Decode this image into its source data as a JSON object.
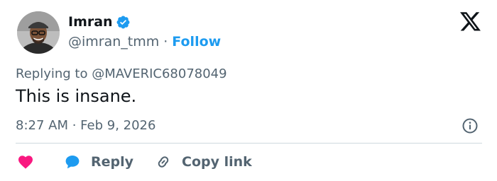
{
  "author": {
    "display_name": "Imran",
    "handle": "@imran_tmm",
    "separator": "·",
    "follow_label": "Follow",
    "verified": true,
    "verified_color": "#1d9bf0"
  },
  "tweet": {
    "replying_to": "Replying to @MAVERIC68078049",
    "text": "This is insane.",
    "timestamp": "8:27 AM · Feb 9, 2026"
  },
  "actions": {
    "like_color": "#f91880",
    "reply_label": "Reply",
    "reply_color": "#1d9bf0",
    "copy_link_label": "Copy link"
  },
  "icons": [
    "avatar",
    "verified-icon",
    "x-logo-icon",
    "info-icon",
    "heart-icon",
    "reply-bubble-icon",
    "link-icon"
  ]
}
